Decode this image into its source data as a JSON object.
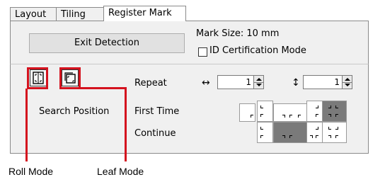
{
  "tabs": [
    {
      "label": "Layout",
      "active": false
    },
    {
      "label": "Tiling",
      "active": false
    },
    {
      "label": "Register Mark",
      "active": true
    }
  ],
  "exit_detection_label": "Exit Detection",
  "mark_size_label": "Mark Size: 10 mm",
  "id_certification": {
    "label": "ID Certification Mode",
    "checked": false
  },
  "modes": {
    "roll_icon": "roll-mode-icon",
    "leaf_icon": "leaf-mode-icon"
  },
  "repeat": {
    "label": "Repeat",
    "horizontal_symbol": "↔",
    "horizontal_value": "1",
    "vertical_symbol": "↕",
    "vertical_value": "1"
  },
  "search_position": {
    "label": "Search Position",
    "first_time_label": "First Time",
    "continue_label": "Continue"
  },
  "captions": {
    "roll_mode": "Roll Mode",
    "leaf_mode": "Leaf Mode"
  },
  "colors": {
    "highlight": "#d4121e",
    "selected_cell": "#7a7a7a"
  }
}
